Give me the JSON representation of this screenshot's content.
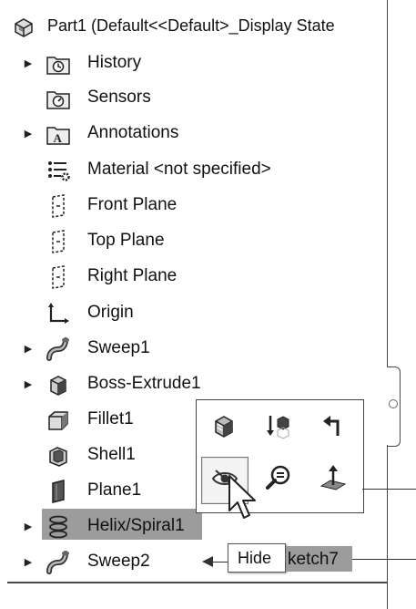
{
  "tree": {
    "root_label": "Part1  (Default<<Default>_Display State",
    "items": [
      {
        "label": "History",
        "icon": "history-folder-icon",
        "expandable": true
      },
      {
        "label": "Sensors",
        "icon": "sensors-folder-icon",
        "expandable": false
      },
      {
        "label": "Annotations",
        "icon": "annotations-folder-icon",
        "expandable": true
      },
      {
        "label": "Material <not specified>",
        "icon": "material-icon",
        "expandable": false
      },
      {
        "label": "Front Plane",
        "icon": "plane-icon",
        "expandable": false
      },
      {
        "label": "Top Plane",
        "icon": "plane-icon",
        "expandable": false
      },
      {
        "label": "Right Plane",
        "icon": "plane-icon",
        "expandable": false
      },
      {
        "label": "Origin",
        "icon": "origin-icon",
        "expandable": false
      },
      {
        "label": "Sweep1",
        "icon": "sweep-icon",
        "expandable": true
      },
      {
        "label": "Boss-Extrude1",
        "icon": "boss-extrude-icon",
        "expandable": true
      },
      {
        "label": "Fillet1",
        "icon": "fillet-icon",
        "expandable": false
      },
      {
        "label": "Shell1",
        "icon": "shell-icon",
        "expandable": false
      },
      {
        "label": "Plane1",
        "icon": "plane1-icon",
        "expandable": false
      },
      {
        "label": "Helix/Spiral1",
        "icon": "helix-icon",
        "expandable": true,
        "selected": true
      },
      {
        "label": "Sweep2",
        "icon": "sweep-icon",
        "expandable": true
      }
    ]
  },
  "sketch_label": "ketch7",
  "tooltip": {
    "text": "Hide"
  },
  "context_toolbar": {
    "buttons": [
      {
        "name": "appearance-button",
        "icon": "appearance-icon"
      },
      {
        "name": "rollback-button",
        "icon": "rollback-icon"
      },
      {
        "name": "select-other-button",
        "icon": "select-other-icon"
      },
      {
        "name": "hide-button",
        "icon": "eye-hide-icon",
        "highlighted": true
      },
      {
        "name": "zoom-to-selection-button",
        "icon": "zoom-to-selection-icon"
      },
      {
        "name": "normal-to-button",
        "icon": "normal-to-icon"
      }
    ]
  }
}
